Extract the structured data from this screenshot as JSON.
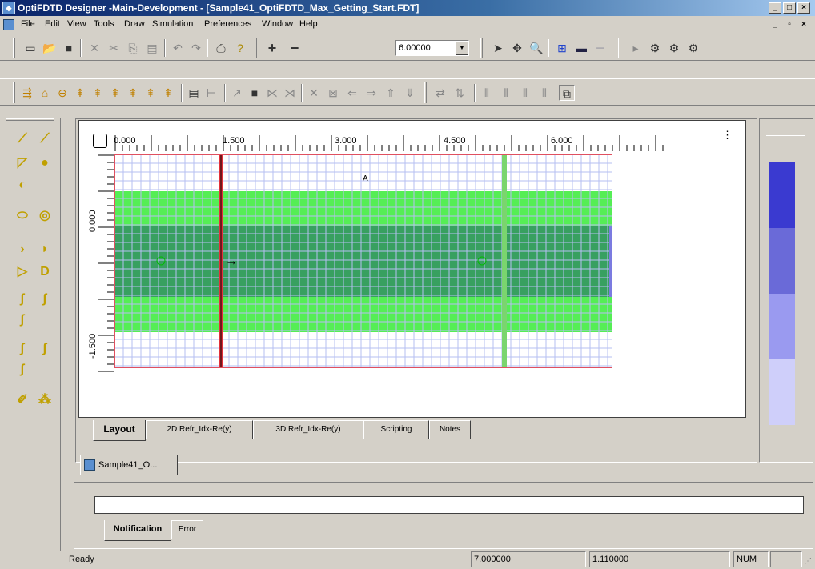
{
  "window": {
    "title": "OptiFDTD Designer -Main-Development - [Sample41_OptiFDTD_Max_Getting_Start.FDT]",
    "app_icon": "optifdtd-app-icon",
    "controls": [
      "_",
      "□",
      "×"
    ],
    "mdi_controls": [
      "_",
      "▫",
      "×"
    ]
  },
  "menu": [
    "File",
    "Edit",
    "View",
    "Tools",
    "Draw",
    "Simulation",
    "Preferences",
    "Window",
    "Help"
  ],
  "toolbar1": {
    "step_value": "6.00000",
    "buttons": [
      "new-icon",
      "open-icon",
      "save-icon",
      "delete-icon",
      "cut-icon",
      "copy-icon",
      "paste-icon",
      "undo-icon",
      "redo-icon",
      "print-icon",
      "help-icon",
      "zoom-in-icon",
      "zoom-out-icon",
      "pointer-icon",
      "pan-icon",
      "zoom-icon",
      "grid-icon",
      "input-plane-icon",
      "observation-icon",
      "run-icon",
      "simulate-icon",
      "simulate-3d-icon",
      "analyze-icon"
    ]
  },
  "toolbar2": {
    "buttons": [
      "waveguide-icon",
      "fiber-icon",
      "lens-icon",
      "bend-icon",
      "taper-icon",
      "ytaper-icon",
      "coupler-icon",
      "array-icon",
      "layer-icon",
      "select-icon",
      "rect-icon",
      "fill-icon",
      "line-icon",
      "slope-icon",
      "cross-icon",
      "stretch-icon",
      "arrow-left-icon",
      "arrow-right-icon",
      "arrow-up-icon",
      "arrow-down-icon",
      "swap-h-icon",
      "swap-v-icon",
      "align-left-icon",
      "align-center-icon",
      "align-right-icon",
      "align-top-icon",
      "properties-icon"
    ]
  },
  "palette": [
    "linear-waveguide-icon",
    "arc-waveguide-icon",
    "taper-icon",
    "lens-icon",
    "channel-icon",
    "ellipse-icon",
    "circle-ring-icon",
    "triangle-icon",
    "half-circle-icon",
    "play-shape-icon",
    "d-shape-icon",
    "sbend-icon",
    "sbend-sine-icon",
    "sbend-arc-icon",
    "sbend-cos-icon",
    "sbend-cos2-icon",
    "sbend-poly-icon",
    "port-icon",
    "coupler-grid-icon"
  ],
  "ruler": {
    "x_labels": [
      "0.000",
      "1.500",
      "3.000",
      "4.500",
      "6.000"
    ],
    "y_labels": [
      "0.000",
      "-1.500"
    ],
    "marker": "A"
  },
  "layout": {
    "label": "A",
    "colors": {
      "cladding": "#ffffff",
      "grid": "#b6bff2",
      "green_layer": "#55ee55",
      "core": "#38a060",
      "input_plane": "#e3303a",
      "observation_plane": "#7ad56e",
      "boundary": "#e05060"
    }
  },
  "tabs": [
    "Layout",
    "2D Refr_Idx-Re(y)",
    "3D Refr_Idx-Re(y)",
    "Scripting",
    "Notes"
  ],
  "document_tab": "Sample41_O...",
  "notification": {
    "tabs": [
      "Notification",
      "Error"
    ],
    "text": ""
  },
  "status": {
    "text": "Ready",
    "x": "7.000000",
    "y": "1.110000",
    "num": "NUM"
  },
  "right_legend": {
    "colors": [
      "#3a3ad0",
      "#6a6ad8",
      "#9a9af0",
      "#cfcffa"
    ]
  }
}
